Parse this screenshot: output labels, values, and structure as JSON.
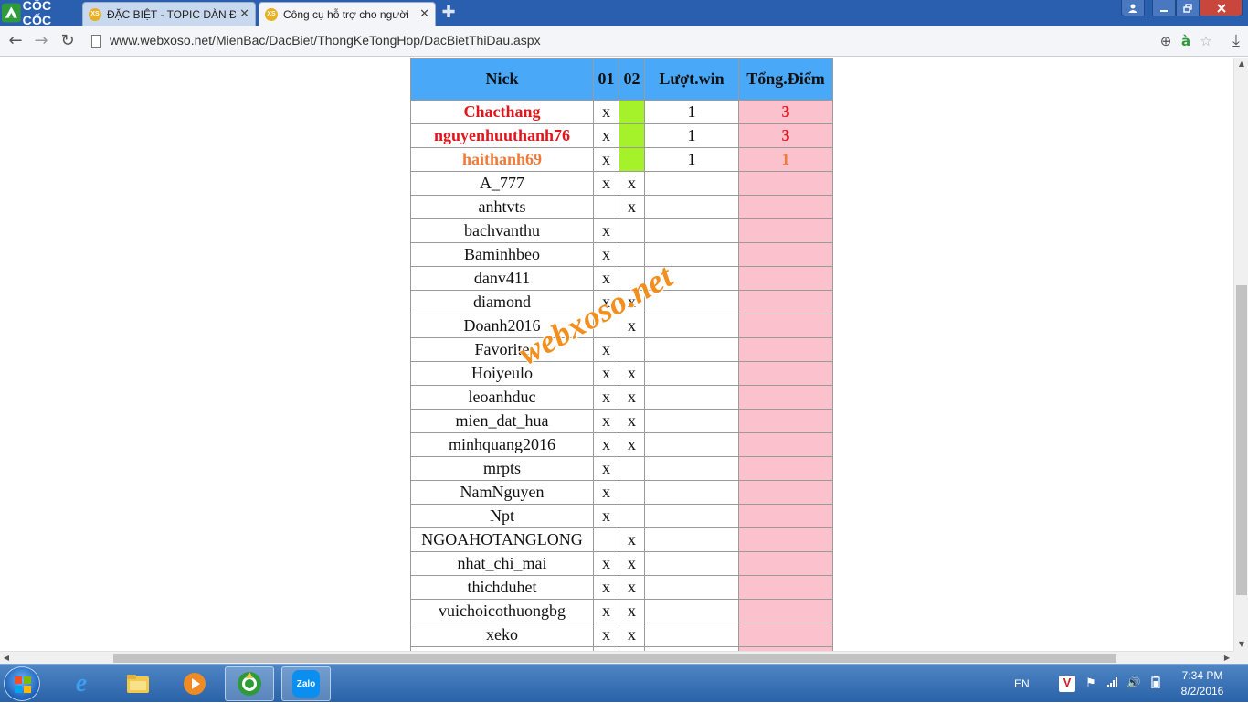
{
  "browser": {
    "brand": "CỐC CỐC",
    "tabs": [
      {
        "title": "ĐẶC BIỆT - TOPIC DÀN ĐẶ",
        "favicon": "XS",
        "active": false
      },
      {
        "title": "Công cụ hỗ trợ cho người",
        "favicon": "XS",
        "active": true
      }
    ],
    "url": "www.webxoso.net/MienBac/DacBiet/ThongKeTongHop/DacBietThiDau.aspx"
  },
  "table": {
    "headers": {
      "nick": "Nick",
      "c01": "01",
      "c02": "02",
      "win": "Lượt.win",
      "points": "Tổng.Điểm"
    },
    "rows": [
      {
        "nick": "Chacthang",
        "c01": "x",
        "c02": "",
        "win": "1",
        "points": "3",
        "style": "red",
        "c02_green": true
      },
      {
        "nick": "nguyenhuuthanh76",
        "c01": "x",
        "c02": "",
        "win": "1",
        "points": "3",
        "style": "red",
        "c02_green": true
      },
      {
        "nick": "haithanh69",
        "c01": "x",
        "c02": "",
        "win": "1",
        "points": "1",
        "style": "orange",
        "c02_green": true
      },
      {
        "nick": "A_777",
        "c01": "x",
        "c02": "x",
        "win": "",
        "points": "",
        "style": "normal",
        "c02_green": false
      },
      {
        "nick": "anhtvts",
        "c01": "",
        "c02": "x",
        "win": "",
        "points": "",
        "style": "normal",
        "c02_green": false
      },
      {
        "nick": "bachvanthu",
        "c01": "x",
        "c02": "",
        "win": "",
        "points": "",
        "style": "normal",
        "c02_green": false
      },
      {
        "nick": "Baminhbeo",
        "c01": "x",
        "c02": "",
        "win": "",
        "points": "",
        "style": "normal",
        "c02_green": false
      },
      {
        "nick": "danv411",
        "c01": "x",
        "c02": "",
        "win": "",
        "points": "",
        "style": "normal",
        "c02_green": false
      },
      {
        "nick": "diamond",
        "c01": "x",
        "c02": "x",
        "win": "",
        "points": "",
        "style": "normal",
        "c02_green": false
      },
      {
        "nick": "Doanh2016",
        "c01": "",
        "c02": "x",
        "win": "",
        "points": "",
        "style": "normal",
        "c02_green": false
      },
      {
        "nick": "Favorite",
        "c01": "x",
        "c02": "",
        "win": "",
        "points": "",
        "style": "normal",
        "c02_green": false
      },
      {
        "nick": "Hoiyeulo",
        "c01": "x",
        "c02": "x",
        "win": "",
        "points": "",
        "style": "normal",
        "c02_green": false
      },
      {
        "nick": "leoanhduc",
        "c01": "x",
        "c02": "x",
        "win": "",
        "points": "",
        "style": "normal",
        "c02_green": false
      },
      {
        "nick": "mien_dat_hua",
        "c01": "x",
        "c02": "x",
        "win": "",
        "points": "",
        "style": "normal",
        "c02_green": false
      },
      {
        "nick": "minhquang2016",
        "c01": "x",
        "c02": "x",
        "win": "",
        "points": "",
        "style": "normal",
        "c02_green": false
      },
      {
        "nick": "mrpts",
        "c01": "x",
        "c02": "",
        "win": "",
        "points": "",
        "style": "normal",
        "c02_green": false
      },
      {
        "nick": "NamNguyen",
        "c01": "x",
        "c02": "",
        "win": "",
        "points": "",
        "style": "normal",
        "c02_green": false
      },
      {
        "nick": "Npt",
        "c01": "x",
        "c02": "",
        "win": "",
        "points": "",
        "style": "normal",
        "c02_green": false
      },
      {
        "nick": "NGOAHOTANGLONG",
        "c01": "",
        "c02": "x",
        "win": "",
        "points": "",
        "style": "normal",
        "c02_green": false
      },
      {
        "nick": "nhat_chi_mai",
        "c01": "x",
        "c02": "x",
        "win": "",
        "points": "",
        "style": "normal",
        "c02_green": false
      },
      {
        "nick": "thichduhet",
        "c01": "x",
        "c02": "x",
        "win": "",
        "points": "",
        "style": "normal",
        "c02_green": false
      },
      {
        "nick": "vuichoicothuongbg",
        "c01": "x",
        "c02": "x",
        "win": "",
        "points": "",
        "style": "normal",
        "c02_green": false
      },
      {
        "nick": "xeko",
        "c01": "x",
        "c02": "x",
        "win": "",
        "points": "",
        "style": "normal",
        "c02_green": false
      },
      {
        "nick": "",
        "c01": "",
        "c02": "",
        "win": "",
        "points": "",
        "style": "normal",
        "c02_green": false
      }
    ]
  },
  "watermark": "webxoso.net",
  "colors": {
    "header": "#4aa8f8",
    "points_bg": "#fbc1cc",
    "win_green": "#a6f22a",
    "red": "#e0161c",
    "orange": "#f07a3a"
  },
  "taskbar": {
    "apps": [
      {
        "name": "ie-icon",
        "label": "e"
      },
      {
        "name": "explorer-icon",
        "label": ""
      },
      {
        "name": "media-player-icon",
        "label": ""
      },
      {
        "name": "coccoc-icon",
        "label": ""
      },
      {
        "name": "zalo-icon",
        "label": "Zalo"
      }
    ],
    "language": "EN",
    "time": "7:34 PM",
    "date": "8/2/2016"
  }
}
